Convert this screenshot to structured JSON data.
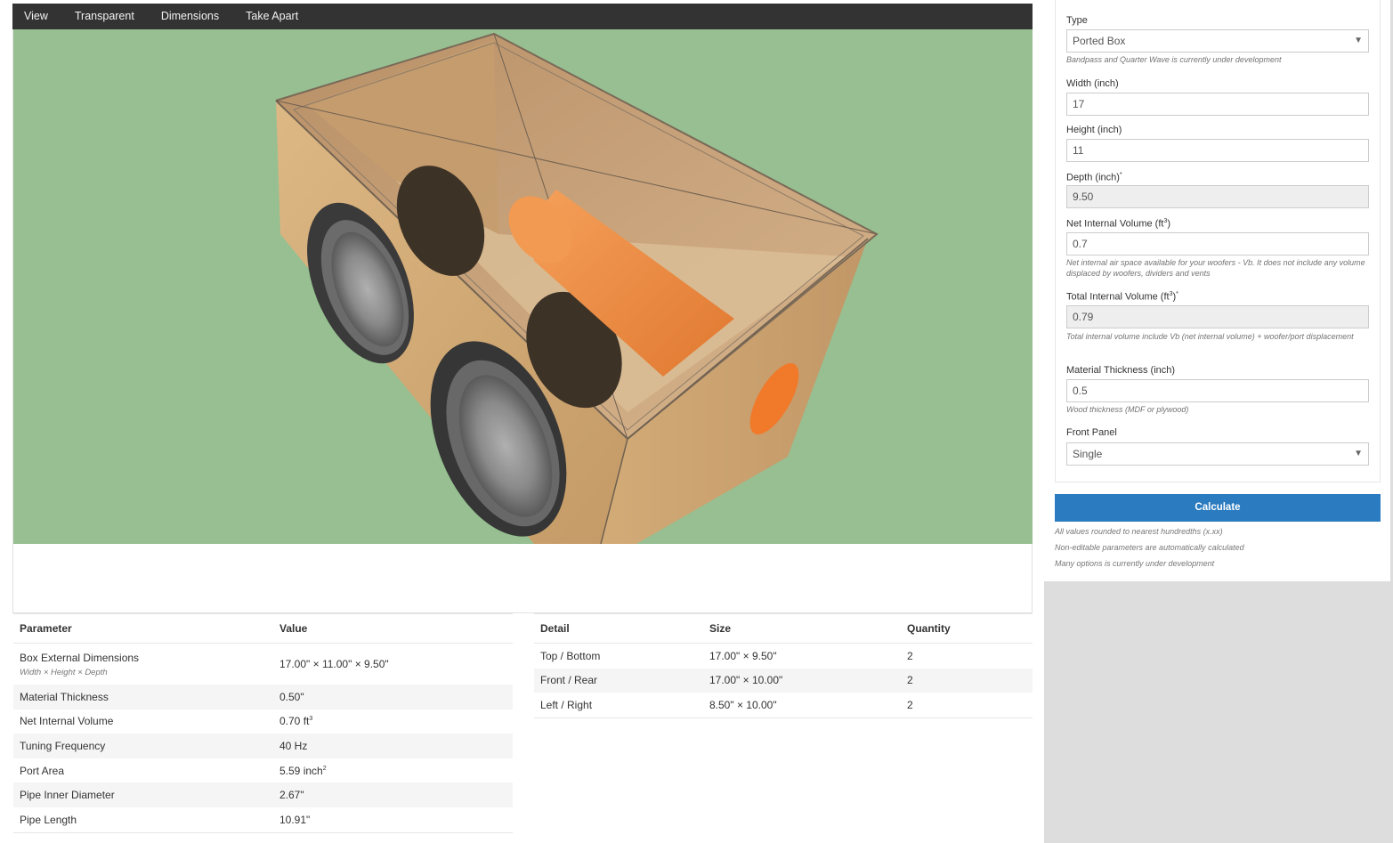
{
  "menu": [
    "View",
    "Transparent",
    "Dimensions",
    "Take Apart"
  ],
  "form": {
    "type_label": "Type",
    "type_value": "Ported Box",
    "type_help": "Bandpass and Quarter Wave is currently under development",
    "width_label": "Width (inch)",
    "width_value": "17",
    "height_label": "Height (inch)",
    "height_value": "11",
    "depth_label": "Depth (inch)",
    "depth_value": "9.50",
    "net_label": "Net Internal Volume (ft",
    "net_value": "0.7",
    "net_help": "Net internal air space available for your woofers - Vb. It does not include any volume displaced by woofers, dividers and vents",
    "total_label": "Total Internal Volume (ft",
    "total_value": "0.79",
    "total_help": "Total internal volume include Vb (net internal volume) + woofer/port displacement",
    "thickness_label": "Material Thickness (inch)",
    "thickness_value": "0.5",
    "thickness_help": "Wood thickness (MDF or plywood)",
    "front_label": "Front Panel",
    "front_value": "Single",
    "calculate_label": "Calculate",
    "notes": [
      "All values rounded to nearest hundredths (x.xx)",
      "Non-editable parameters are automatically calculated",
      "Many options is currently under development"
    ]
  },
  "params": {
    "headers": [
      "Parameter",
      "Value"
    ],
    "box_name": "Box External Dimensions",
    "box_sub": "Width × Height × Depth",
    "box_value": "17.00\" × 11.00\" × 9.50\"",
    "rows": [
      {
        "name": "Material Thickness",
        "value": "0.50\""
      },
      {
        "name": "Net Internal Volume",
        "value": "0.70 ft"
      },
      {
        "name": "Tuning Frequency",
        "value": "40 Hz"
      },
      {
        "name": "Port Area",
        "value": "5.59 inch"
      },
      {
        "name": "Pipe Inner Diameter",
        "value": "2.67\""
      },
      {
        "name": "Pipe Length",
        "value": "10.91\""
      }
    ]
  },
  "details": {
    "headers": [
      "Detail",
      "Size",
      "Quantity"
    ],
    "rows": [
      {
        "detail": "Top / Bottom",
        "size": "17.00\" × 9.50\"",
        "qty": "2"
      },
      {
        "detail": "Front / Rear",
        "size": "17.00\" × 10.00\"",
        "qty": "2"
      },
      {
        "detail": "Left / Right",
        "size": "8.50\" × 10.00\"",
        "qty": "2"
      }
    ]
  },
  "colors": {
    "viewport_bg": "#97bf91",
    "menubar": "#333333",
    "button": "#2b7bc0",
    "wood": "#d8b581",
    "port": "#f08a3e"
  }
}
